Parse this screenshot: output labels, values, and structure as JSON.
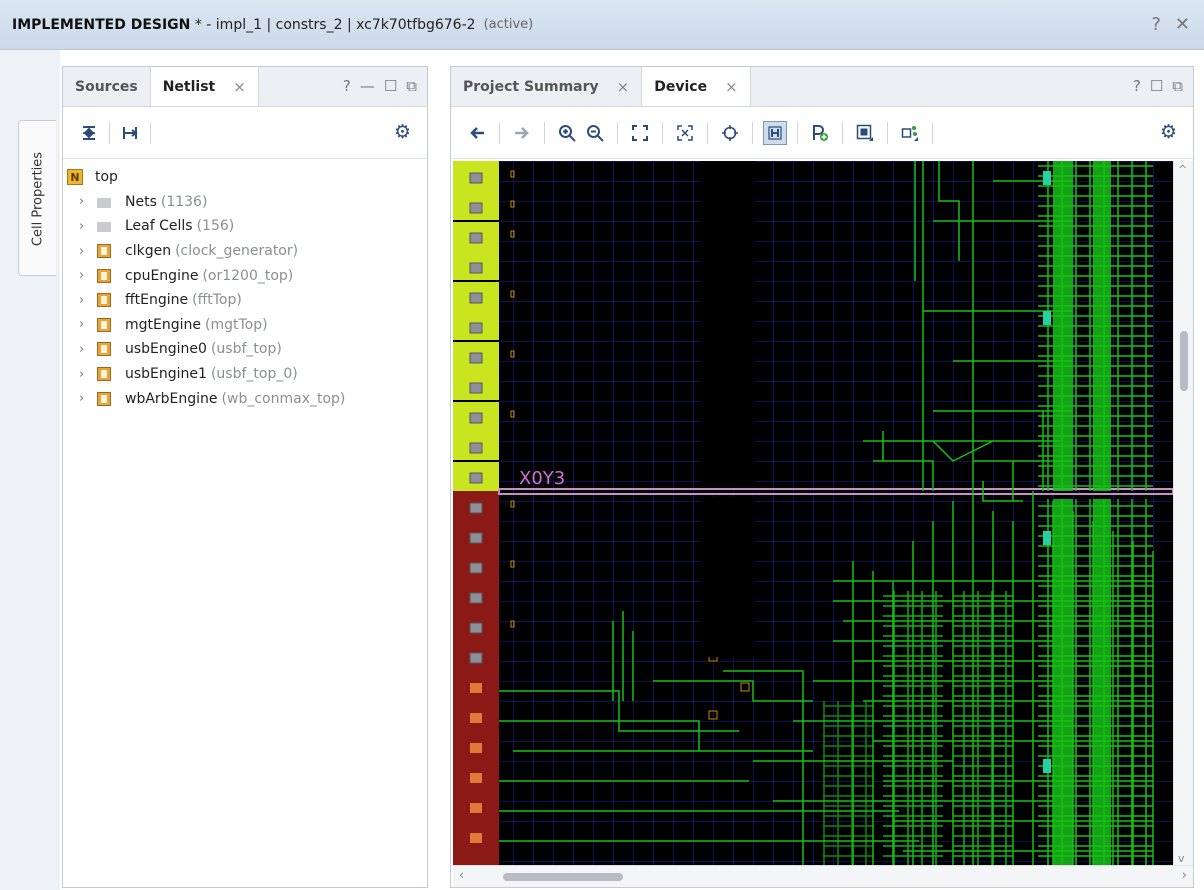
{
  "title": {
    "main": "IMPLEMENTED DESIGN",
    "rest": " * - impl_1 | constrs_2 | xc7k70tfbg676-2",
    "status": "(active)",
    "help": "?",
    "close": "✕"
  },
  "side_tab": {
    "label": "Cell Properties"
  },
  "left_panel": {
    "tabs": [
      {
        "label": "Sources"
      },
      {
        "label": "Netlist",
        "close": "×"
      }
    ],
    "buttons": {
      "help": "?",
      "minimize": "—",
      "maximize": "☐",
      "float": "⧉"
    },
    "toolbar": {
      "collapse": "⇞",
      "expand": "⊢",
      "settings": "⚙"
    },
    "tree": {
      "root": {
        "label": "top",
        "icon": "N"
      },
      "items": [
        {
          "name": "Nets",
          "detail": "(1136)",
          "icon": "folder"
        },
        {
          "name": "Leaf Cells",
          "detail": "(156)",
          "icon": "folder"
        },
        {
          "name": "clkgen",
          "detail": "(clock_generator)",
          "icon": "cell"
        },
        {
          "name": "cpuEngine",
          "detail": "(or1200_top)",
          "icon": "cell"
        },
        {
          "name": "fftEngine",
          "detail": "(fftTop)",
          "icon": "cell"
        },
        {
          "name": "mgtEngine",
          "detail": "(mgtTop)",
          "icon": "cell"
        },
        {
          "name": "usbEngine0",
          "detail": "(usbf_top)",
          "icon": "cell"
        },
        {
          "name": "usbEngine1",
          "detail": "(usbf_top_0)",
          "icon": "cell"
        },
        {
          "name": "wbArbEngine",
          "detail": "(wb_conmax_top)",
          "icon": "cell"
        }
      ]
    }
  },
  "right_panel": {
    "tabs": [
      {
        "label": "Project Summary",
        "close": "×"
      },
      {
        "label": "Device",
        "close": "×"
      }
    ],
    "buttons": {
      "help": "?",
      "maximize": "☐",
      "float": "⧉"
    },
    "toolbar_icons": [
      "back-arrow-icon",
      "forward-arrow-icon",
      "zoom-in-icon",
      "zoom-out-icon",
      "zoom-fit-icon",
      "zoom-selection-icon",
      "crosshair-icon",
      "routing-resources-icon",
      "add-pblock-icon",
      "pblock-view-icon",
      "select-area-icon",
      "settings-icon"
    ],
    "device": {
      "region_label": "X0Y3",
      "colors": {
        "upper_column": "#c9e51f",
        "lower_column": "#8b1a17",
        "grid": "#1c23a8",
        "nets": "#18c018",
        "divider": "#c890c8",
        "label": "#d070d0",
        "cell": "#c88a00"
      }
    }
  }
}
